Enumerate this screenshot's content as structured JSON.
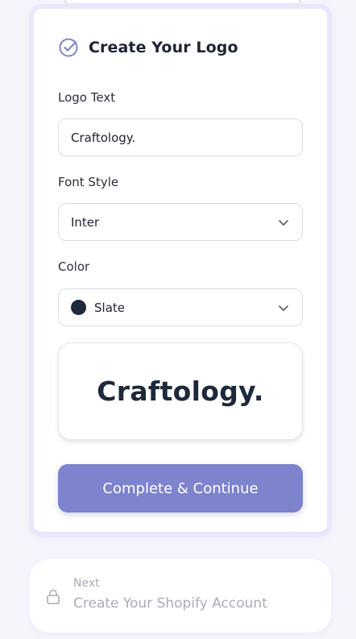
{
  "card": {
    "title": "Create Your Logo",
    "fields": {
      "logo_text": {
        "label": "Logo Text",
        "value": "Craftology."
      },
      "font_style": {
        "label": "Font Style",
        "value": "Inter"
      },
      "color": {
        "label": "Color",
        "value": "Slate",
        "swatch": "#1e293b"
      }
    },
    "preview_text": "Craftology.",
    "cta_label": "Complete & Continue"
  },
  "next_step": {
    "eyebrow": "Next",
    "title": "Create Your Shopify Account",
    "locked": true
  },
  "colors": {
    "accent": "#7d83cd",
    "page_bg": "#f6f5fc",
    "card_border": "#e8e8fb",
    "text": "#1f2433",
    "muted": "#a9adb8"
  }
}
